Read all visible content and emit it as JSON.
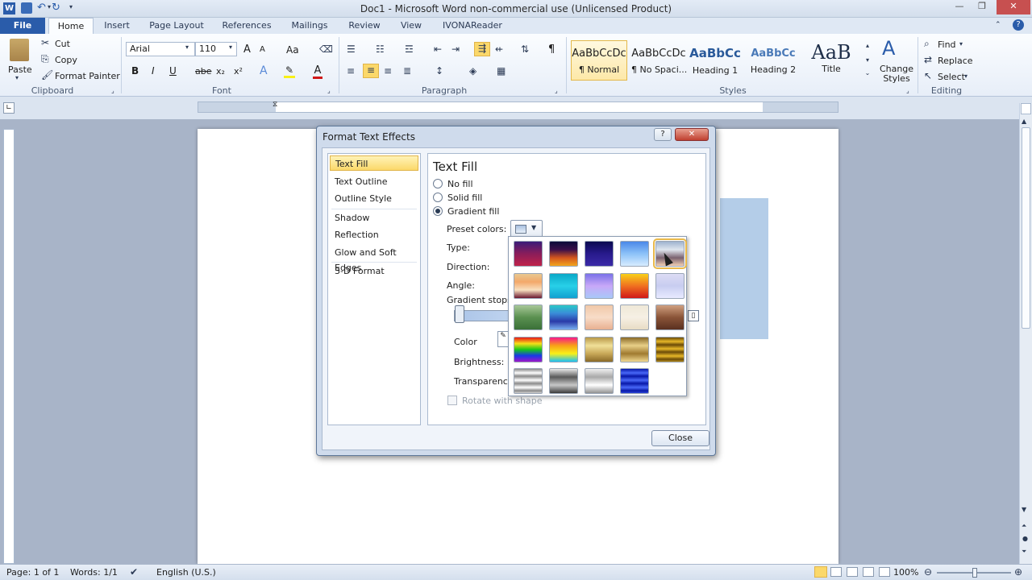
{
  "window": {
    "title": "Doc1 - Microsoft Word non-commercial use (Unlicensed Product)"
  },
  "qat": {
    "word_icon": "word-logo-icon",
    "save": "save-icon",
    "undo": "undo-icon",
    "redo": "redo-icon",
    "customize": "qat-dropdown-icon"
  },
  "tabs": [
    "File",
    "Home",
    "Insert",
    "Page Layout",
    "References",
    "Mailings",
    "Review",
    "View",
    "IVONAReader"
  ],
  "clipboard": {
    "paste": "Paste",
    "cut": "Cut",
    "copy": "Copy",
    "format_painter": "Format Painter",
    "label": "Clipboard"
  },
  "font": {
    "name": "Arial",
    "size": "110",
    "label": "Font",
    "bold": "B",
    "italic": "I",
    "underline": "U",
    "strike": "abe",
    "sub": "x₂",
    "sup": "x²",
    "case": "Aa",
    "grow": "A",
    "shrink": "A"
  },
  "paragraph": {
    "label": "Paragraph",
    "pilcrow": "¶"
  },
  "styles": {
    "label": "Styles",
    "items": [
      {
        "preview": "AaBbCcDc",
        "name": "¶ Normal"
      },
      {
        "preview": "AaBbCcDc",
        "name": "¶ No Spaci..."
      },
      {
        "preview": "AaBbCc",
        "name": "Heading 1"
      },
      {
        "preview": "AaBbCc",
        "name": "Heading 2"
      },
      {
        "preview": "AaB",
        "name": "Title"
      }
    ],
    "change": "Change Styles"
  },
  "editing": {
    "label": "Editing",
    "find": "Find",
    "replace": "Replace",
    "select": "Select"
  },
  "dialog": {
    "title": "Format Text Effects",
    "help": "?",
    "close_x": "✕",
    "nav": [
      "Text Fill",
      "Text Outline",
      "Outline Style",
      "Shadow",
      "Reflection",
      "Glow and Soft Edges",
      "3-D Format"
    ],
    "section": "Text Fill",
    "radios": [
      "No fill",
      "Solid fill",
      "Gradient fill"
    ],
    "preset": "Preset colors:",
    "type": "Type:",
    "direction": "Direction:",
    "angle": "Angle:",
    "stops": "Gradient stops",
    "color": "Color",
    "brightness": "Brightness:",
    "transparency": "Transparency",
    "rotate": "Rotate with shape",
    "close": "Close"
  },
  "gradients": [
    "linear-gradient(#3a1c78,#8a1d5a,#c0234a)",
    "linear-gradient(#0b0b3a,#3a0f4a,#d2551e,#f3a51e)",
    "linear-gradient(#0a0a50,#281a8c,#3a2aa8)",
    "linear-gradient(#4a88e8,#8cc2f8,#d6ecff)",
    "linear-gradient(#9fb3cf,#dfe6ef,#7a6270,#f2d0b4)",
    "linear-gradient(#e8c890,#f3a86a,#f8e0c0,#6a1830)",
    "linear-gradient(#0aa8c8,#28d0e8,#10a0d0)",
    "linear-gradient(#7a72e8,#c8a8f8,#a8c8f8)",
    "linear-gradient(#f8d018,#f07020,#d01818)",
    "linear-gradient(#dcdcf4,#c8cdf0,#e8eaff)",
    "linear-gradient(#a8c898,#5a9050,#3a7038)",
    "linear-gradient(#2ac8c8,#3a8cd8,#2a3aa8,#7ab0f0)",
    "linear-gradient(#f0c8a8,#f8dcc8,#e8b090)",
    "linear-gradient(#efe8d8,#f6f0e4,#e8dcc4)",
    "linear-gradient(#d0a080,#8a5438,#5a3020)",
    "linear-gradient(#e81818,#f8e018,#18c818,#1838e8,#a018c8)",
    "linear-gradient(#f81888,#f8a018,#f8f018,#18c0f8)",
    "linear-gradient(#b89848,#f0e098,#c8a858,#8a6a28)",
    "linear-gradient(#8a6a28,#e8d088,#a07a30,#f0d890)",
    "repeating-linear-gradient(#6a4a08 0px,#e8b828 5px,#6a4a08 9px)",
    "repeating-linear-gradient(#8a8a8a 0px,#ffffff 5px,#8a8a8a 9px)",
    "linear-gradient(#e8e8e8,#5a5a5a,#c8c8c8,#3a3a3a)",
    "linear-gradient(#f0f0f0,#a8a8a8,#ffffff,#909090)",
    "repeating-linear-gradient(#0818a8 0px,#4868f8 5px,#0818a8 9px)"
  ],
  "status": {
    "page": "Page: 1 of 1",
    "words": "Words: 1/1",
    "lang": "English (U.S.)",
    "zoom": "100%"
  }
}
